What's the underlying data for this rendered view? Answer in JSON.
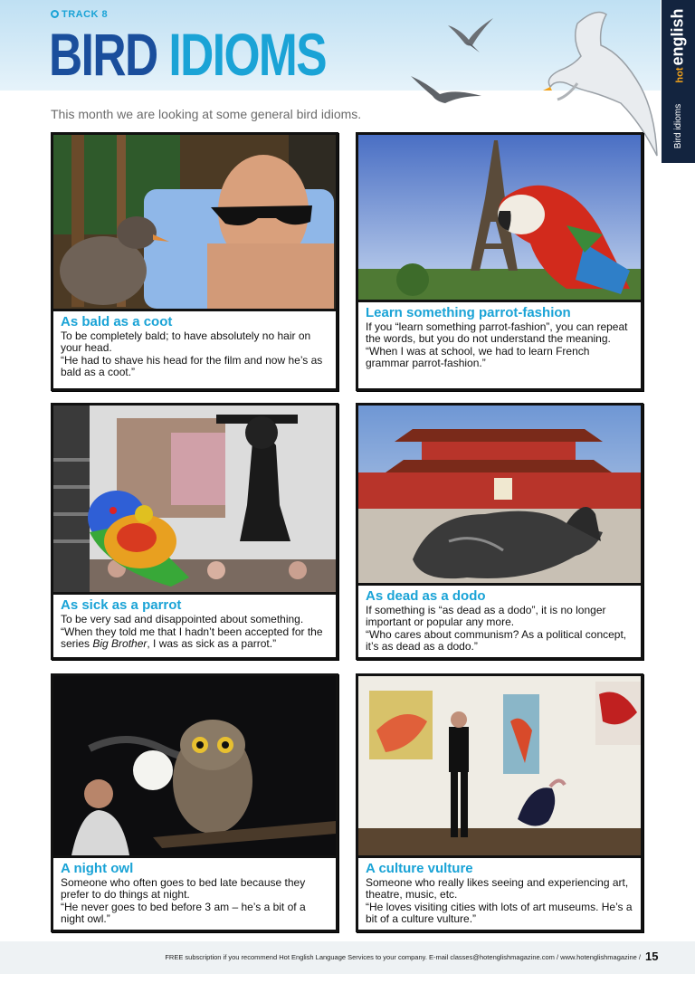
{
  "header": {
    "track": "TRACK 8",
    "title_word1": "BIRD",
    "title_word2": "IDIOMS",
    "subtitle": "This month we are looking at some general bird idioms."
  },
  "side_tab": {
    "brand_small": "hot",
    "brand": "english",
    "section": "Bird idioms"
  },
  "cards": [
    {
      "heading": "As bald as a coot",
      "definition": "To be completely bald; to have absolutely no hair on your head.",
      "example": "“He had to shave his head for the film and now he’s as bald as a coot.”"
    },
    {
      "heading": "Learn something parrot-fashion",
      "definition": "If you “learn something parrot-fashion”, you can repeat the words, but you do not understand the meaning.",
      "example": "“When I was at school, we had to learn French grammar parrot-fashion.”"
    },
    {
      "heading": "As sick as a parrot",
      "definition": "To be very sad and disappointed about something.",
      "example_pre": "“When they told me that I hadn’t been accepted for the series ",
      "example_italic": "Big Brother",
      "example_post": ", I was as sick as a parrot.”"
    },
    {
      "heading": "As dead as a dodo",
      "definition": "If something is “as dead as a dodo”, it is no longer important or popular any more.",
      "example": "“Who cares about communism? As a political concept, it’s as dead as a dodo.”"
    },
    {
      "heading": "A night owl",
      "definition": "Someone who often goes to bed late because they prefer to do things at night.",
      "example": "“He never goes to bed before 3 am – he’s a bit of a night owl.”"
    },
    {
      "heading": "A culture vulture",
      "definition": "Someone who really likes seeing and experiencing art, theatre, music, etc.",
      "example": "“He loves visiting cities with lots of art museums. He’s a bit of a culture vulture.”"
    }
  ],
  "footer": {
    "text": "FREE subscription if you recommend Hot English Language Services to your company. E-mail classes@hotenglishmagazine.com / www.hotenglishmagazine /",
    "page": "15"
  },
  "colors": {
    "title_dark": "#1a4e9c",
    "accent": "#1aa3d6",
    "side_tab": "#13243f"
  }
}
